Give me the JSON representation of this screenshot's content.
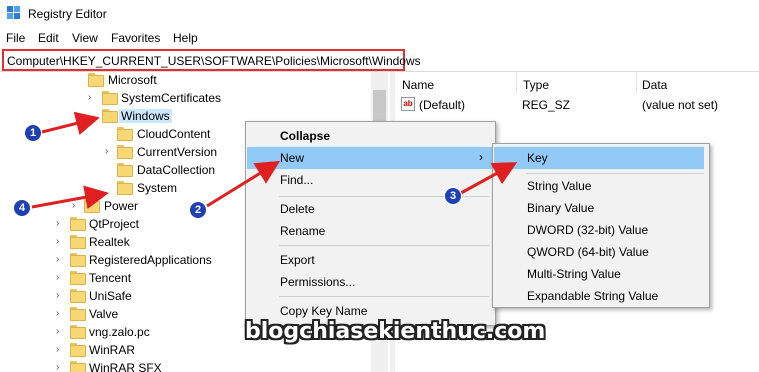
{
  "window": {
    "title": "Registry Editor"
  },
  "menu": [
    "File",
    "Edit",
    "View",
    "Favorites",
    "Help"
  ],
  "address": "Computer\\HKEY_CURRENT_USER\\SOFTWARE\\Policies\\Microsoft\\Windows",
  "tree": {
    "microsoft": "Microsoft",
    "system_certificates": "SystemCertificates",
    "windows": "Windows",
    "cloud_content": "CloudContent",
    "current_version": "CurrentVersion",
    "data_collection": "DataCollection",
    "system": "System",
    "power": "Power",
    "qtproject": "QtProject",
    "realtek": "Realtek",
    "registered_apps": "RegisteredApplications",
    "tencent": "Tencent",
    "unisafe": "UniSafe",
    "valve": "Valve",
    "vng": "vng.zalo.pc",
    "winrar": "WinRAR",
    "winrar_sfx": "WinRAR SFX"
  },
  "list": {
    "headers": {
      "name": "Name",
      "type": "Type",
      "data": "Data"
    },
    "rows": [
      {
        "name": "(Default)",
        "type": "REG_SZ",
        "data": "(value not set)"
      }
    ]
  },
  "context_menu": {
    "collapse": "Collapse",
    "new": "New",
    "find": "Find...",
    "delete": "Delete",
    "rename": "Rename",
    "export": "Export",
    "permissions": "Permissions...",
    "copy_key_name": "Copy Key Name"
  },
  "submenu": {
    "key": "Key",
    "string_value": "String Value",
    "binary_value": "Binary Value",
    "dword": "DWORD (32-bit) Value",
    "qword": "QWORD (64-bit) Value",
    "multi_string": "Multi-String Value",
    "expandable_string": "Expandable String Value"
  },
  "markers": [
    "1",
    "2",
    "3",
    "4"
  ],
  "watermark": "blogchiasekienthuc.com",
  "colors": {
    "highlight": "#91c9f7",
    "marker": "#1f3fb5",
    "arrow": "#e02020",
    "address_border": "#e03030"
  }
}
